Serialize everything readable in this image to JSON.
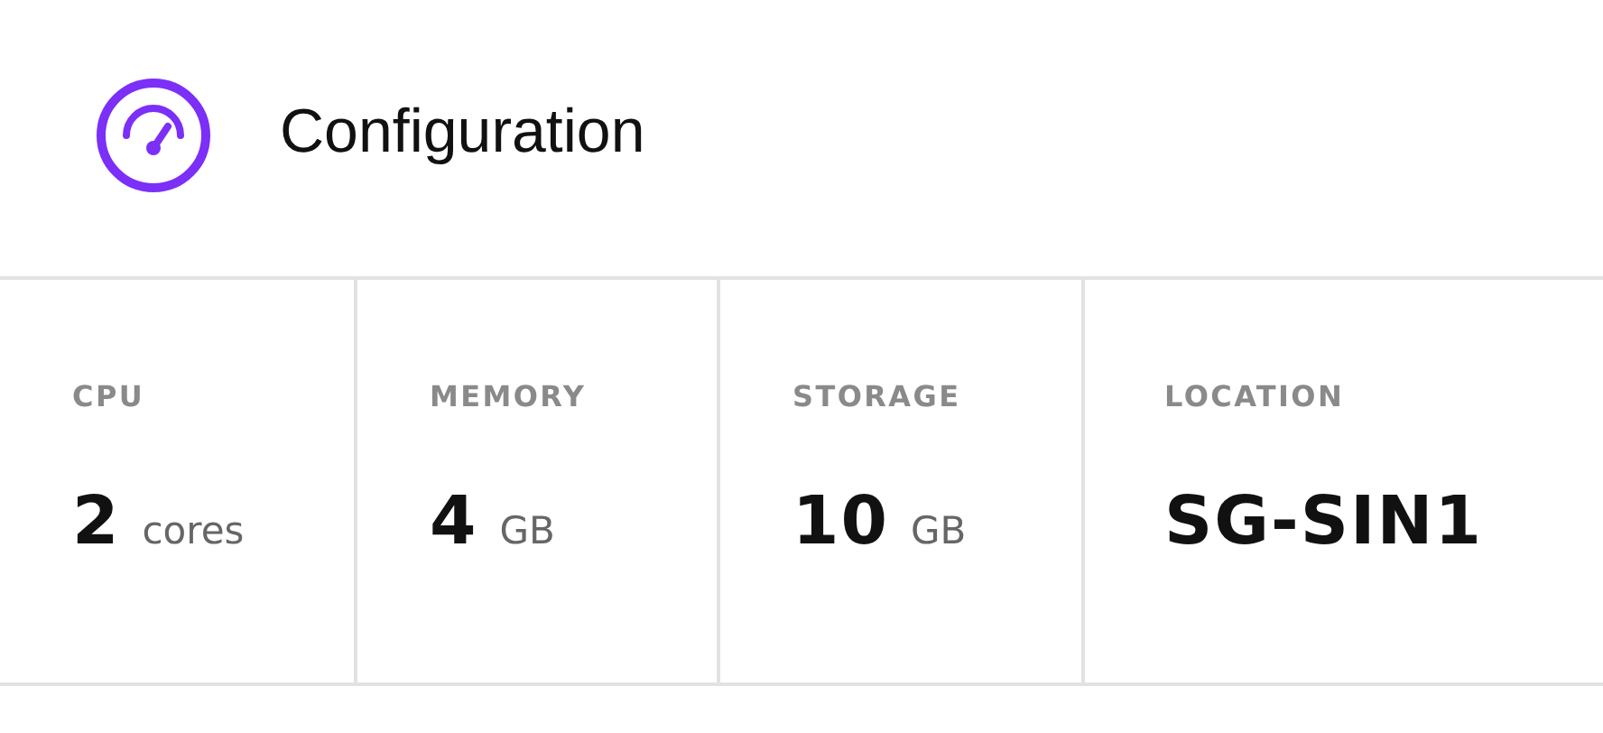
{
  "header": {
    "title": "Configuration"
  },
  "stats": [
    {
      "label": "CPU",
      "value": "2",
      "unit": "cores"
    },
    {
      "label": "MEMORY",
      "value": "4",
      "unit": "GB"
    },
    {
      "label": "STORAGE",
      "value": "10",
      "unit": "GB"
    },
    {
      "label": "LOCATION",
      "value": "SG-SIN1"
    }
  ]
}
